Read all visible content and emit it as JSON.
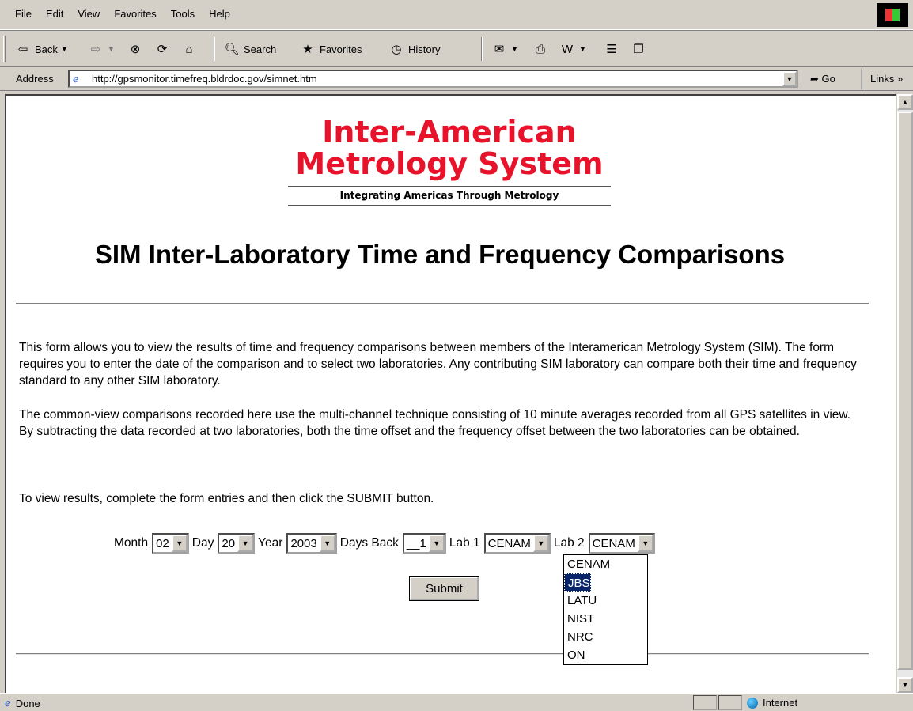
{
  "menu": [
    "File",
    "Edit",
    "View",
    "Favorites",
    "Tools",
    "Help"
  ],
  "toolbar": {
    "back": "Back",
    "search": "Search",
    "favorites": "Favorites",
    "history": "History"
  },
  "address": {
    "label": "Address",
    "url": "http://gpsmonitor.timefreq.bldrdoc.gov/simnet.htm",
    "go": "Go",
    "links": "Links"
  },
  "logo": {
    "line1": "Inter-American",
    "line2": "Metrology System",
    "tagline": "Integrating Americas Through Metrology",
    "color": "#e8122b"
  },
  "page": {
    "title": "SIM Inter-Laboratory Time and Frequency Comparisons",
    "p1": "This form allows you to view the results of time and frequency comparisons between members of the Interamerican Metrology System (SIM). The form requires you to enter the date of the comparison and to select two laboratories. Any contributing SIM laboratory can compare both their time and frequency standard to any other SIM laboratory.",
    "p2": "The common-view comparisons recorded here use the multi-channel technique consisting of 10 minute averages recorded from all GPS satellites in view. By subtracting the data recorded at two laboratories, both the time offset and the frequency offset between the two laboratories can be obtained.",
    "p3": "To view results, complete the form entries and then click the SUBMIT button."
  },
  "form": {
    "month_label": "Month",
    "month": "02",
    "day_label": "Day",
    "day": "20",
    "year_label": "Year",
    "year": "2003",
    "daysback_label": "Days Back",
    "daysback": "__1",
    "lab1_label": "Lab 1",
    "lab1": "CENAM",
    "lab2_label": "Lab 2",
    "lab2": "CENAM",
    "submit": "Submit",
    "lab_options": [
      "CENAM",
      "JBS",
      "LATU",
      "NIST",
      "NRC",
      "ON"
    ],
    "highlighted_option": "JBS"
  },
  "status": {
    "text": "Done",
    "zone": "Internet"
  }
}
